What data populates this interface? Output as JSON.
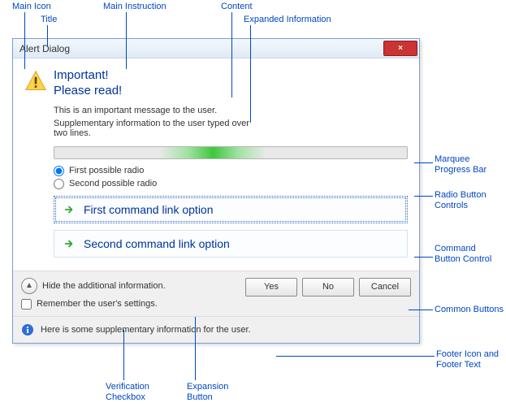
{
  "callouts": {
    "main_icon": "Main Icon",
    "title": "Title",
    "main_instruction": "Main Instruction",
    "content": "Content",
    "expanded_info": "Expanded Information",
    "marquee": "Marquee\nProgress Bar",
    "radio_controls": "Radio Button\nControls",
    "command_button": "Command\nButton Control",
    "common_buttons": "Common Buttons",
    "footer_icon_text": "Footer Icon and\nFooter Text",
    "verification": "Verification\nCheckbox",
    "expansion": "Expansion\nButton"
  },
  "dialog": {
    "title": "Alert Dialog",
    "close_glyph": "×",
    "instruction_line1": "Important!",
    "instruction_line2": "Please read!",
    "content_text": "This is an important message to the user.",
    "expanded_text": "Supplementary information to the user typed over two lines.",
    "radio1": "First possible radio",
    "radio2": "Second possible radio",
    "cmd1": "First command link option",
    "cmd2": "Second command link option",
    "hide_text": "Hide the additional information.",
    "remember_text": "Remember the user's settings.",
    "yes": "Yes",
    "no": "No",
    "cancel": "Cancel",
    "footer_text": "Here is some supplementary information for the user."
  }
}
